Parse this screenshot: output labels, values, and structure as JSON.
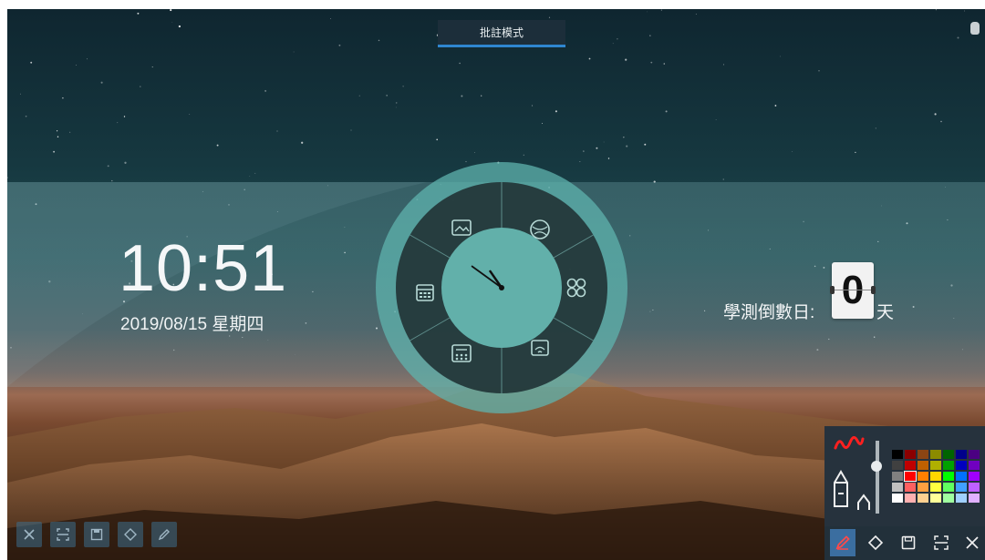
{
  "header": {
    "mode_label": "批註模式"
  },
  "clock": {
    "time": "10:51",
    "date": "2019/08/15  星期四"
  },
  "radial_menu": {
    "items": [
      {
        "icon": "image-gallery-icon"
      },
      {
        "icon": "globe-browser-icon"
      },
      {
        "icon": "apps-grid-icon"
      },
      {
        "icon": "screen-cast-icon"
      },
      {
        "icon": "calculator-icon"
      },
      {
        "icon": "calendar-icon"
      }
    ],
    "analog_clock": {
      "hour": 10,
      "minute": 51
    }
  },
  "countdown": {
    "label": "學測倒數日:",
    "value": "0",
    "unit": "天"
  },
  "pen_panel": {
    "palette": [
      "#000000",
      "#8b0000",
      "#8b4513",
      "#8b8b00",
      "#006400",
      "#00008b",
      "#4b0082",
      "#404040",
      "#c00000",
      "#c06000",
      "#b0b000",
      "#00a000",
      "#0000c0",
      "#7000c0",
      "#808080",
      "#ff0000",
      "#ff8000",
      "#ffd700",
      "#00ff00",
      "#0070ff",
      "#a000ff",
      "#c0c0c0",
      "#ff6060",
      "#ffa040",
      "#ffff40",
      "#60ff60",
      "#40a0ff",
      "#c060ff",
      "#ffffff",
      "#ffb0b0",
      "#ffd090",
      "#ffff99",
      "#a0ffa0",
      "#a0d0ff",
      "#e0b0ff"
    ],
    "selected_color": "#ff0000",
    "accent_color": "#ff2020"
  },
  "bottom_left_toolbar": [
    "close-icon",
    "region-select-icon",
    "save-icon",
    "eraser-icon",
    "pen-icon"
  ],
  "bottom_right_toolbar": [
    "pen-icon",
    "eraser-icon",
    "save-icon",
    "region-select-icon",
    "close-icon"
  ],
  "colors": {
    "tab_underline": "#2f86d0",
    "radial_ring": "#5fb3ad",
    "radial_dark": "#26383a"
  }
}
